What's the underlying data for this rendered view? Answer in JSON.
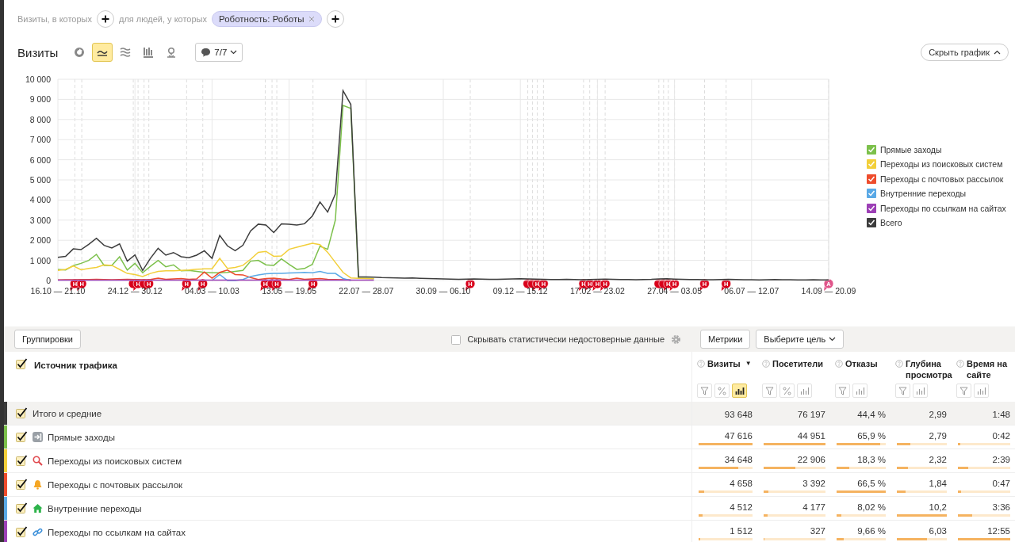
{
  "filter_bar": {
    "visits_label": "Визиты, в которых",
    "people_label": "для людей, у которых",
    "chips": [
      {
        "label": "Роботность: Роботы"
      }
    ]
  },
  "chart_toolbar": {
    "title": "Визиты",
    "chart_types": [
      {
        "kind": "pie",
        "selected": false
      },
      {
        "kind": "line",
        "selected": true
      },
      {
        "kind": "area",
        "selected": false
      },
      {
        "kind": "bar",
        "selected": false
      },
      {
        "kind": "map",
        "selected": false
      }
    ],
    "annotations_button": "7/7",
    "hide_chart_button": "Скрыть график"
  },
  "chart": {
    "legend": [
      {
        "checked": true
      },
      {
        "checked": true
      },
      {
        "checked": true
      },
      {
        "checked": true
      },
      {
        "checked": true
      },
      {
        "checked": true
      }
    ],
    "chart_data": {
      "type": "line",
      "grid": true,
      "ylim": [
        0,
        10000
      ],
      "categories": [
        "16.10 — 21.10",
        null,
        null,
        null,
        null,
        null,
        null,
        null,
        null,
        null,
        "24.12 — 30.12",
        null,
        null,
        null,
        null,
        null,
        null,
        null,
        null,
        null,
        "04.03 — 10.03",
        null,
        null,
        null,
        null,
        null,
        null,
        null,
        null,
        null,
        "13.05 — 19.05",
        null,
        null,
        null,
        null,
        null,
        null,
        null,
        null,
        null,
        "22.07 — 28.07",
        null,
        null,
        null,
        null,
        null,
        null,
        null,
        null,
        null,
        "30.09 — 06.10",
        null,
        null,
        null,
        null,
        null,
        null,
        null,
        null,
        null,
        "09.12 — 15.12",
        null,
        null,
        null,
        null,
        null,
        null,
        null,
        null,
        null,
        "17.02 — 23.02",
        null,
        null,
        null,
        null,
        null,
        null,
        null,
        null,
        null,
        "27.04 — 03.05",
        null,
        null,
        null,
        null,
        null,
        null,
        null,
        null,
        null,
        "06.07 — 12.07",
        null,
        null,
        null,
        null,
        null,
        null,
        null,
        null,
        null,
        "14.09 — 20.09"
      ],
      "yticks": [
        {
          "value": 0,
          "label": "0"
        },
        {
          "value": 1000,
          "label": "1 000"
        },
        {
          "value": 2000,
          "label": "2 000"
        },
        {
          "value": 3000,
          "label": "3 000"
        },
        {
          "value": 4000,
          "label": "4 000"
        },
        {
          "value": 5000,
          "label": "5 000"
        },
        {
          "value": 6000,
          "label": "6 000"
        },
        {
          "value": 7000,
          "label": "7 000"
        },
        {
          "value": 8000,
          "label": "8 000"
        },
        {
          "value": 9000,
          "label": "9 000"
        },
        {
          "value": 10000,
          "label": "10 000"
        }
      ],
      "series": [
        {
          "name": "Прямые заходы",
          "color": "#7cc04b",
          "values": [
            550,
            520,
            740,
            850,
            1000,
            1300,
            750,
            750,
            1180,
            520,
            850,
            380,
            700,
            1000,
            680,
            780,
            480,
            500,
            450,
            400,
            380,
            380,
            400,
            450,
            500,
            960,
            1000,
            780,
            750,
            1080,
            800,
            550,
            600,
            800,
            1700,
            1550,
            3000,
            8700,
            8550,
            120,
            110,
            100,
            null,
            null,
            null,
            null,
            null,
            null,
            null,
            null,
            null,
            null,
            null,
            null,
            null,
            null,
            null,
            null,
            null,
            null,
            null,
            null,
            null,
            null,
            null,
            null,
            null,
            null,
            null,
            null,
            null,
            null,
            null,
            null,
            null,
            null,
            null,
            null,
            null,
            null,
            null,
            null,
            null,
            null,
            null,
            null,
            null,
            null,
            null,
            null,
            null,
            null,
            null,
            null,
            null,
            null,
            null,
            null,
            null,
            null,
            null
          ]
        },
        {
          "name": "Переходы из поисковых систем",
          "color": "#f2cf3a",
          "values": [
            500,
            550,
            720,
            530,
            600,
            650,
            780,
            750,
            550,
            350,
            300,
            200,
            350,
            450,
            480,
            480,
            500,
            520,
            560,
            580,
            580,
            1100,
            600,
            650,
            750,
            1050,
            1400,
            1450,
            1200,
            1220,
            1550,
            1650,
            1750,
            1850,
            1780,
            1400,
            900,
            400,
            130,
            110,
            100,
            90,
            null,
            null,
            null,
            null,
            null,
            null,
            null,
            null,
            null,
            null,
            null,
            null,
            null,
            null,
            null,
            null,
            null,
            null,
            null,
            null,
            null,
            null,
            null,
            null,
            null,
            null,
            null,
            null,
            null,
            null,
            null,
            null,
            null,
            null,
            null,
            null,
            null,
            null,
            null,
            null,
            null,
            null,
            null,
            null,
            null,
            null,
            null,
            null,
            null,
            null,
            null,
            null,
            null,
            null,
            null,
            null,
            null,
            null,
            null
          ]
        },
        {
          "name": "Переходы с почтовых рассылок",
          "color": "#ee4c2c",
          "values": [
            30,
            40,
            40,
            50,
            50,
            60,
            50,
            40,
            50,
            60,
            50,
            40,
            50,
            120,
            60,
            80,
            100,
            60,
            80,
            420,
            120,
            400,
            520,
            300,
            280,
            150,
            50,
            100,
            120,
            80,
            50,
            120,
            60,
            80,
            100,
            60,
            50,
            40,
            30,
            null,
            null,
            null,
            null,
            null,
            null,
            null,
            null,
            null,
            null,
            null,
            null,
            null,
            null,
            null,
            null,
            null,
            null,
            null,
            null,
            null,
            null,
            null,
            null,
            null,
            null,
            null,
            null,
            null,
            null,
            null,
            null,
            null,
            null,
            null,
            null,
            null,
            null,
            null,
            null,
            null,
            null,
            null,
            null,
            null,
            null,
            null,
            null,
            null,
            null,
            null,
            null,
            null,
            null,
            null,
            null,
            null,
            null,
            null,
            null,
            null,
            null
          ]
        },
        {
          "name": "Внутренние переходы",
          "color": "#5aa9e6",
          "values": [
            null,
            null,
            null,
            null,
            null,
            null,
            null,
            null,
            null,
            null,
            null,
            null,
            null,
            null,
            null,
            null,
            null,
            null,
            null,
            null,
            0,
            300,
            0,
            0,
            50,
            200,
            280,
            330,
            350,
            360,
            370,
            380,
            400,
            380,
            450,
            350,
            350,
            100,
            0,
            null,
            null,
            null,
            null,
            null,
            null,
            null,
            null,
            null,
            null,
            null,
            null,
            null,
            null,
            null,
            null,
            null,
            null,
            null,
            null,
            null,
            null,
            null,
            null,
            null,
            null,
            null,
            null,
            null,
            null,
            null,
            null,
            null,
            null,
            null,
            null,
            null,
            null,
            null,
            null,
            null,
            null,
            null,
            null,
            null,
            null,
            null,
            null,
            null,
            null,
            null,
            null,
            null,
            null,
            null,
            null,
            null,
            null,
            null,
            null,
            null,
            null
          ]
        },
        {
          "name": "Переходы по ссылкам на сайтах",
          "color": "#9c3fb5",
          "values": [
            20,
            20,
            20,
            20,
            20,
            20,
            20,
            20,
            20,
            20,
            20,
            20,
            20,
            20,
            20,
            20,
            20,
            20,
            20,
            20,
            20,
            20,
            20,
            20,
            20,
            20,
            20,
            20,
            20,
            20,
            20,
            20,
            20,
            20,
            20,
            20,
            20,
            20,
            20,
            20,
            20,
            20,
            null,
            null,
            null,
            null,
            null,
            null,
            null,
            null,
            null,
            null,
            null,
            null,
            null,
            null,
            null,
            null,
            null,
            null,
            null,
            null,
            null,
            null,
            null,
            null,
            null,
            null,
            null,
            null,
            null,
            null,
            null,
            null,
            null,
            null,
            null,
            null,
            null,
            null,
            null,
            null,
            null,
            null,
            null,
            null,
            null,
            null,
            null,
            null,
            null,
            null,
            null,
            null,
            null,
            null,
            null,
            null,
            null,
            null,
            null
          ]
        },
        {
          "name": "Всего",
          "color": "#3d3d3d",
          "values": [
            1150,
            1200,
            1570,
            1530,
            1800,
            2100,
            1750,
            1620,
            1820,
            960,
            1270,
            500,
            1100,
            1600,
            1260,
            1390,
            1180,
            1130,
            1260,
            1480,
            1100,
            2240,
            1720,
            1480,
            1750,
            2460,
            2800,
            2760,
            2380,
            2820,
            2800,
            2750,
            2820,
            3200,
            3900,
            3400,
            4300,
            9430,
            8750,
            180,
            180,
            170,
            150,
            140,
            130,
            120,
            130,
            110,
            100,
            90,
            80,
            70,
            60,
            70,
            80,
            70,
            60,
            60,
            70,
            80,
            90,
            80,
            70,
            60,
            50,
            50,
            60,
            50,
            40,
            50,
            60,
            70,
            60,
            50,
            50,
            40,
            50,
            60,
            80,
            90,
            70,
            60,
            50,
            50,
            40,
            40,
            50,
            60,
            50,
            40,
            40,
            30,
            40,
            50,
            40,
            40,
            30,
            30,
            40,
            30,
            30
          ]
        }
      ]
    },
    "event_markers": [
      {
        "kind": "single",
        "text": "Н"
      },
      {
        "kind": "single",
        "text": "Н"
      },
      {
        "kind": "stack",
        "text": "Н"
      },
      {
        "kind": "stack",
        "text": "Н"
      },
      {
        "kind": "single",
        "text": "Н"
      },
      {
        "kind": "single",
        "text": "Н"
      },
      {
        "kind": "single",
        "text": "Н"
      },
      {
        "kind": "stack",
        "text": "Н"
      },
      {
        "kind": "single",
        "text": "Н"
      },
      {
        "kind": "single",
        "text": "Н"
      },
      {
        "kind": "stack3",
        "text": "Н"
      },
      {
        "kind": "single",
        "text": "Н"
      },
      {
        "kind": "single",
        "text": "Н"
      },
      {
        "kind": "single",
        "text": "Н"
      },
      {
        "kind": "single",
        "text": "Н"
      },
      {
        "kind": "single",
        "text": "Н"
      },
      {
        "kind": "stack3",
        "text": "Н"
      },
      {
        "kind": "single",
        "text": "Н"
      },
      {
        "kind": "single",
        "text": "Н"
      },
      {
        "kind": "single",
        "text": "Н"
      },
      {
        "kind": "alert",
        "text": "А"
      }
    ]
  },
  "table_toolbar": {
    "groupings_button": "Группировки",
    "hide_unreliable": {
      "label": "Скрывать статистически недостоверные данные",
      "checked": false
    },
    "metrics_button": "Метрики",
    "goal_dropdown": "Выберите цель"
  },
  "table": {
    "dimension_header": {
      "label": "Источник трафика",
      "checked": true
    },
    "columns": [
      {
        "label": "Визиты",
        "sort": "▼",
        "tools": [
          {
            "kind": "filter",
            "selected": false
          },
          {
            "kind": "percent",
            "selected": false
          },
          {
            "kind": "bars",
            "selected": true
          }
        ]
      },
      {
        "label": "Посетители",
        "tools": [
          {
            "kind": "filter",
            "selected": false
          },
          {
            "kind": "percent",
            "selected": false
          },
          {
            "kind": "bars",
            "selected": false
          }
        ]
      },
      {
        "label": "Отказы",
        "tools": [
          {
            "kind": "filter",
            "selected": false
          },
          {
            "kind": "bars",
            "selected": false
          }
        ]
      },
      {
        "label": "Глубина просмотра",
        "tools": [
          {
            "kind": "filter",
            "selected": false
          },
          {
            "kind": "bars",
            "selected": false
          }
        ]
      },
      {
        "label": "Время на сайте",
        "tools": [
          {
            "kind": "filter",
            "selected": false
          },
          {
            "kind": "bars",
            "selected": false
          }
        ]
      }
    ],
    "rows": [
      {
        "kind": "total",
        "label": "Итого и средние",
        "color": "#3b3b3b",
        "checked": true,
        "cells": [
          {
            "value": "93 648"
          },
          {
            "value": "76 197"
          },
          {
            "value": "44,4 %"
          },
          {
            "value": "2,99"
          },
          {
            "value": "1:48"
          }
        ]
      },
      {
        "kind": "direct",
        "label": "Прямые заходы",
        "color": "#7cc04b",
        "checked": true,
        "cells": [
          {
            "value": "47 616",
            "level": 1
          },
          {
            "value": "44 951",
            "level": 1
          },
          {
            "value": "65,9 %",
            "level": 0.88
          },
          {
            "value": "2,79",
            "level": 0.27
          },
          {
            "value": "0:42",
            "level": 0.05
          }
        ]
      },
      {
        "kind": "search",
        "label": "Переходы из поисковых систем",
        "color": "#f2cf3a",
        "checked": true,
        "cells": [
          {
            "value": "34 648",
            "level": 0.73
          },
          {
            "value": "22 906",
            "level": 0.51
          },
          {
            "value": "18,3 %",
            "level": 0.25
          },
          {
            "value": "2,32",
            "level": 0.23
          },
          {
            "value": "2:39",
            "level": 0.2
          }
        ]
      },
      {
        "kind": "email",
        "label": "Переходы с почтовых рассылок",
        "color": "#ee4c2c",
        "checked": true,
        "cells": [
          {
            "value": "4 658",
            "level": 0.1
          },
          {
            "value": "3 392",
            "level": 0.08
          },
          {
            "value": "66,5 %",
            "level": 1
          },
          {
            "value": "1,84",
            "level": 0.18
          },
          {
            "value": "0:47",
            "level": 0.06
          }
        ]
      },
      {
        "kind": "internal",
        "label": "Внутренние переходы",
        "color": "#5aa9e6",
        "checked": true,
        "cells": [
          {
            "value": "4 512",
            "level": 0.08
          },
          {
            "value": "4 177",
            "level": 0.07
          },
          {
            "value": "8,02 %",
            "level": 0.1
          },
          {
            "value": "10,2",
            "level": 1
          },
          {
            "value": "3:36",
            "level": 0.28
          }
        ]
      },
      {
        "kind": "link",
        "label": "Переходы по ссылкам на сайтах",
        "color": "#9c3fb5",
        "checked": true,
        "cells": [
          {
            "value": "1 512",
            "level": 0.03
          },
          {
            "value": "327",
            "level": 0.01
          },
          {
            "value": "9,66 %",
            "level": 0.14
          },
          {
            "value": "6,03",
            "level": 0.6
          },
          {
            "value": "12:55",
            "level": 1
          }
        ]
      }
    ]
  }
}
